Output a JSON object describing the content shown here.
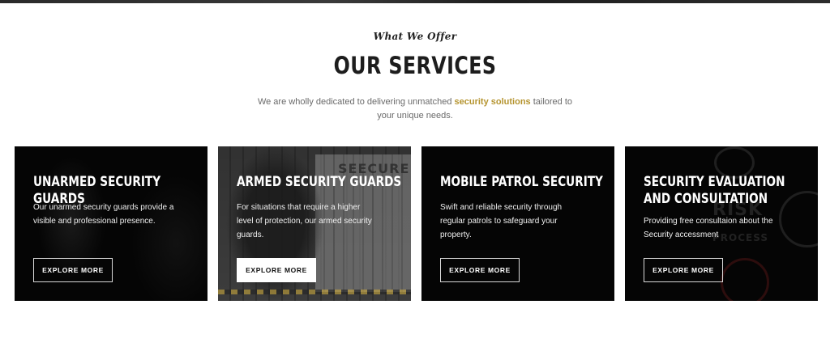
{
  "header": {
    "eyebrow": "What We Offer",
    "title": "OUR SERVICES",
    "subtitle_before": "We are wholly dedicated to delivering unmatched ",
    "subtitle_highlight": "security solutions",
    "subtitle_after": " tailored to your unique needs."
  },
  "colors": {
    "accent": "#b5942f",
    "card_bg": "#050505",
    "title_text": "#1d1d1d"
  },
  "cards": [
    {
      "title": "UNARMED SECURITY GUARDS",
      "description": "Our unarmed security guards provide a visible and professional presence.",
      "button": "EXPLORE MORE"
    },
    {
      "title": "ARMED SECURITY GUARDS",
      "description": "For situations that require a higher level of protection, our armed security guards.",
      "button": "EXPLORE MORE",
      "image_sign": "SEECURE"
    },
    {
      "title": "MOBILE PATROL SECURITY",
      "description": "Swift and reliable security through regular patrols to safeguard your property.",
      "button": "EXPLORE MORE"
    },
    {
      "title": "SECURITY EVALUATION AND CONSULTATION",
      "description": "Providing free consultaion about the Security accessment",
      "button": "EXPLORE MORE",
      "image_text": [
        "RISK",
        "PROCESS"
      ]
    }
  ]
}
